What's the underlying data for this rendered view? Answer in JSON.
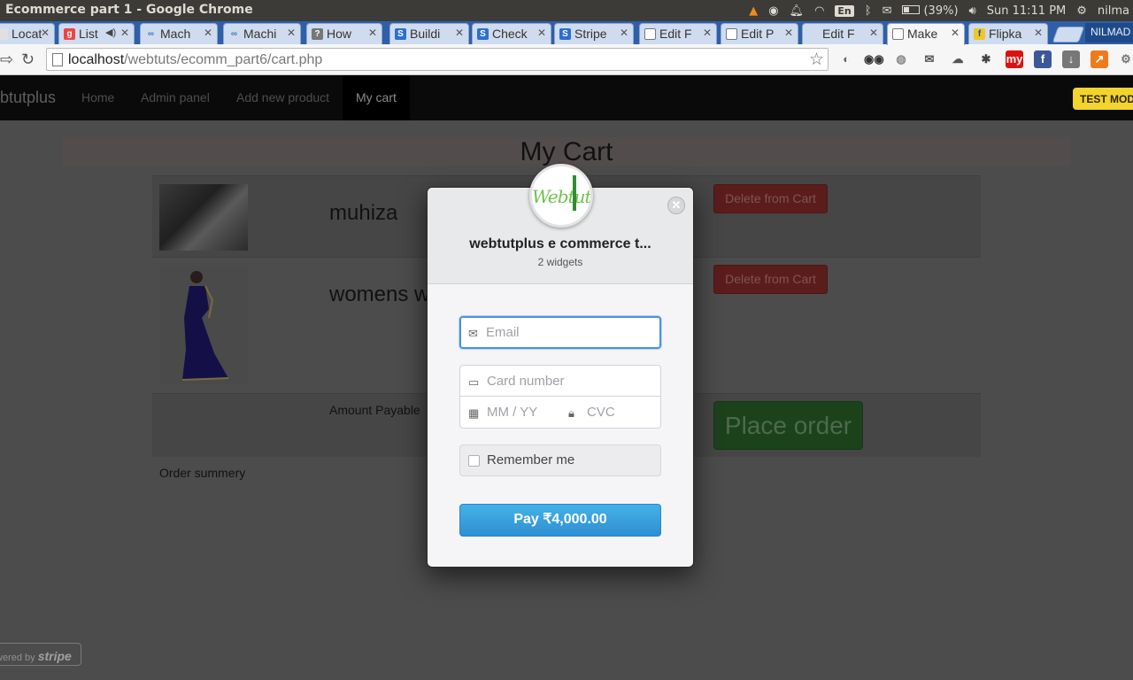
{
  "os": {
    "window_title": "Ecommerce part 1 - Google Chrome",
    "lang": "En",
    "battery": "(39%)",
    "clock": "Sun 11:11 PM",
    "user": "nilma"
  },
  "tabs": [
    {
      "label": "Locat",
      "fav_color": "#e0e0e0",
      "fav_glyph": ""
    },
    {
      "label": "List",
      "fav_color": "#e44",
      "fav_glyph": "g"
    },
    {
      "label": "Mach",
      "fav_color": "#3a78d0",
      "fav_glyph": "∞"
    },
    {
      "label": "Machi",
      "fav_color": "#3a78d0",
      "fav_glyph": "∞"
    },
    {
      "label": "How",
      "fav_color": "#777",
      "fav_glyph": "?"
    },
    {
      "label": "Buildi",
      "fav_color": "#2d6fd1",
      "fav_glyph": "S"
    },
    {
      "label": "Check",
      "fav_color": "#2d6fd1",
      "fav_glyph": "S"
    },
    {
      "label": "Stripe",
      "fav_color": "#2d6fd1",
      "fav_glyph": "S"
    },
    {
      "label": "Edit F",
      "fav_color": "#fff",
      "fav_glyph": ""
    },
    {
      "label": "Edit P",
      "fav_color": "#fff",
      "fav_glyph": ""
    },
    {
      "label": "Edit F",
      "fav_color": "#fff",
      "fav_glyph": ""
    },
    {
      "label": "Make",
      "fav_color": "#fff",
      "fav_glyph": ""
    },
    {
      "label": "Flipka",
      "fav_color": "#f3c623",
      "fav_glyph": "f"
    }
  ],
  "profile_label": "NILMAD",
  "address_bar": {
    "host": "localhost",
    "path": "/webtuts/ecomm_part6/cart.php"
  },
  "site_nav": {
    "brand": "btutplus",
    "links": [
      "Home",
      "Admin panel",
      "Add new product",
      "My cart"
    ],
    "test_mode": "TEST MODE"
  },
  "cart": {
    "title": "My Cart",
    "items": [
      {
        "name": "muhiza",
        "delete_label": "Delete from Cart"
      },
      {
        "name": "womens w",
        "delete_label": "Delete from Cart"
      }
    ],
    "amount_label": "Amount Payable",
    "place_order_label": "Place order",
    "order_summary_label": "Order summery"
  },
  "powered_by": {
    "prefix": "wered by",
    "brand": "stripe"
  },
  "checkout": {
    "logo_text": "Webtut",
    "merchant": "webtutplus e commerce t...",
    "description": "2 widgets",
    "email_placeholder": "Email",
    "card_placeholder": "Card number",
    "exp_placeholder": "MM / YY",
    "cvc_placeholder": "CVC",
    "remember_label": "Remember me",
    "pay_label": "Pay ₹4,000.00"
  }
}
